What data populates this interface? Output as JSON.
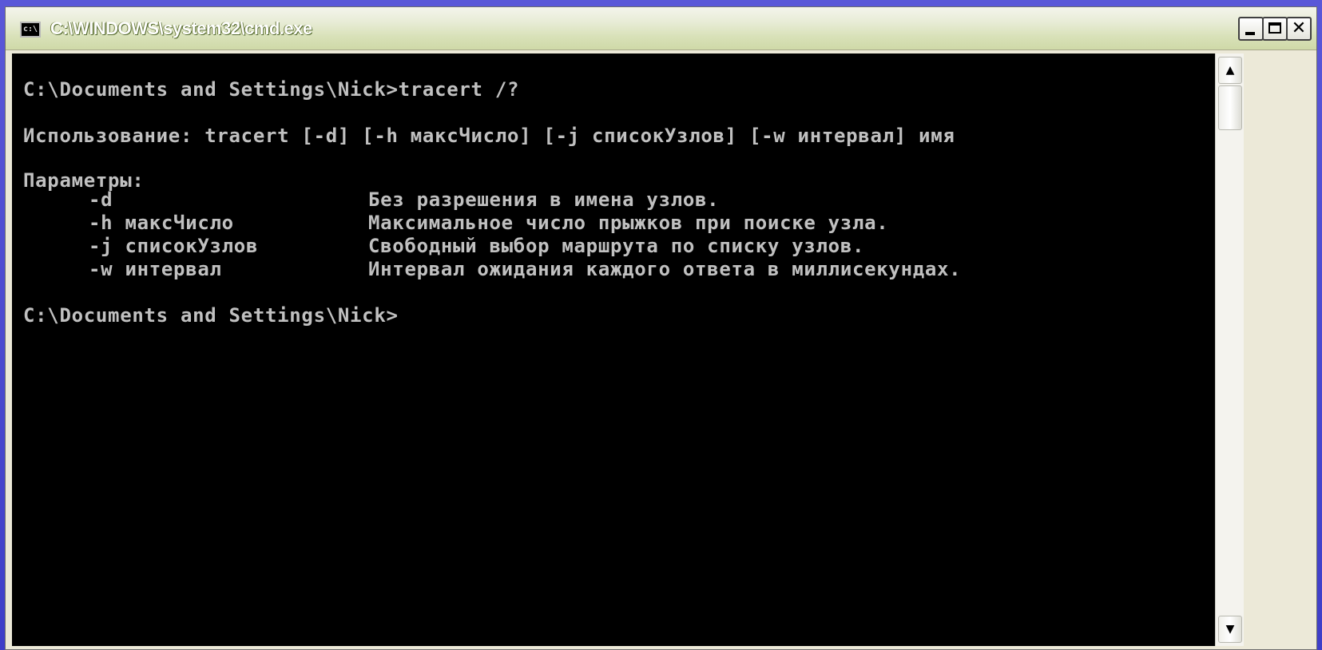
{
  "window": {
    "title": "C:\\WINDOWS\\system32\\cmd.exe",
    "icon": "console-icon",
    "icon_text": "c:\\",
    "controls": {
      "minimize": "minimize-icon",
      "maximize": "maximize-icon",
      "close": "close-icon",
      "close_glyph": "✕"
    }
  },
  "console": {
    "prompt_command": "C:\\Documents and Settings\\Nick>tracert /?",
    "usage": "Использование: tracert [-d] [-h максЧисло] [-j списокУзлов] [-w интервал] имя",
    "params_header": "Параметры:",
    "params": [
      {
        "flag": "-d",
        "description": "Без разрешения в имена узлов."
      },
      {
        "flag": "-h максЧисло",
        "description": "Максимальное число прыжков при поиске узла."
      },
      {
        "flag": "-j списокУзлов",
        "description": "Свободный выбор маршрута по списку узлов."
      },
      {
        "flag": "-w интервал",
        "description": "Интервал ожидания каждого ответа в миллисекундах."
      }
    ],
    "prompt_final": "C:\\Documents and Settings\\Nick>"
  },
  "scrollbar": {
    "up_glyph": "▲",
    "down_glyph": "▼"
  },
  "colors": {
    "console_bg": "#000000",
    "console_text": "#c0c0c0",
    "titlebar": "#d8e1b8"
  }
}
